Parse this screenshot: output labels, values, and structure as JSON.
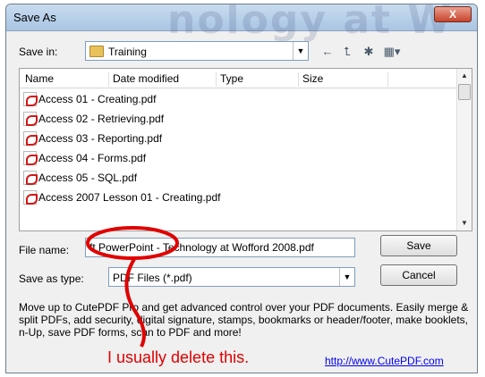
{
  "dialog": {
    "title": "Save As",
    "background_text": "nology at W",
    "close_label": "X"
  },
  "save_in": {
    "label": "Save in:",
    "value": "Training"
  },
  "toolbar": {
    "icons": [
      "back-arrow-icon",
      "up-folder-icon",
      "new-folder-icon",
      "views-menu-icon"
    ]
  },
  "file_list": {
    "columns": [
      "Name",
      "Date modified",
      "Type",
      "Size"
    ],
    "items": [
      "Access 01 - Creating.pdf",
      "Access 02 - Retrieving.pdf",
      "Access 03 - Reporting.pdf",
      "Access 04 - Forms.pdf",
      "Access 05 - SQL.pdf",
      "Access 2007 Lesson 01 - Creating.pdf"
    ]
  },
  "file_name": {
    "label": "File name:",
    "value": "ft PowerPoint - Technology at Wofford 2008.pdf"
  },
  "save_as_type": {
    "label": "Save as type:",
    "value": "PDF Files (*.pdf)"
  },
  "buttons": {
    "save": "Save",
    "cancel": "Cancel"
  },
  "promo": {
    "text": "Move up to CutePDF Pro and get advanced control over your PDF documents. Easily merge & split PDFs, add security, digital signature, stamps, bookmarks or header/footer, make booklets, n-Up, save PDF forms, scan to PDF and more!",
    "link": "http://www.CutePDF.com"
  },
  "annotation": {
    "text": "I usually delete this.",
    "color": "#e00000"
  }
}
